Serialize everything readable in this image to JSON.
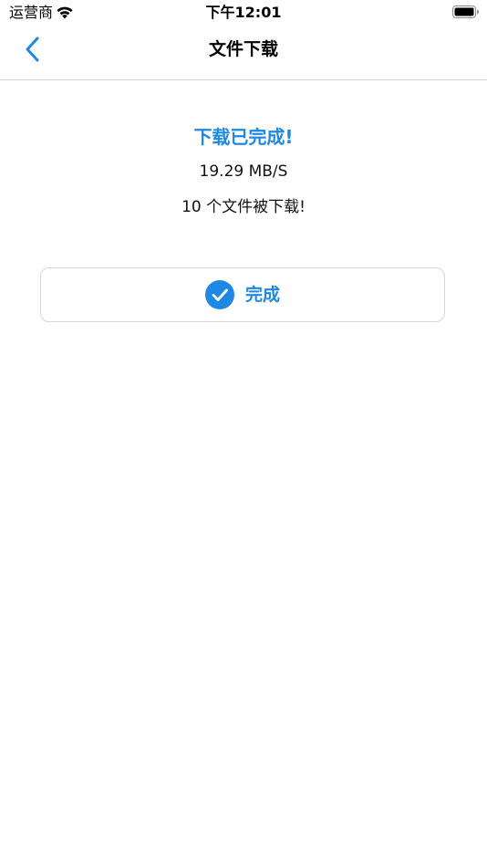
{
  "status_bar": {
    "carrier": "运营商",
    "time": "下午12:01"
  },
  "nav": {
    "title": "文件下载",
    "back_icon": "chevron-left-icon"
  },
  "content": {
    "status_title": "下载已完成!",
    "speed": "19.29 MB/S",
    "count": "10 个文件被下载!"
  },
  "done_button": {
    "label": "完成",
    "icon": "checkmark-circle-icon"
  },
  "colors": {
    "accent": "#1e88e5",
    "divider": "#d5d5d8",
    "button_border": "#d6d6d6"
  }
}
